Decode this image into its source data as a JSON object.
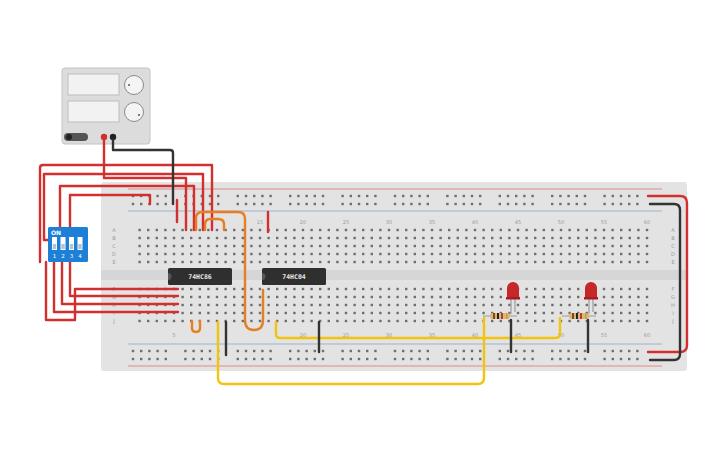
{
  "breadboard": {
    "top_column_labels": [
      "15",
      "20",
      "25",
      "30",
      "35",
      "40",
      "45",
      "50",
      "55",
      "60"
    ],
    "bottom_column_labels": [
      "5",
      "20",
      "25",
      "30",
      "35",
      "40",
      "45",
      "50",
      "55",
      "60"
    ],
    "row_labels_top": [
      "A",
      "B",
      "C",
      "D",
      "E"
    ],
    "row_labels_bottom": [
      "F",
      "G",
      "H",
      "I",
      "J"
    ]
  },
  "chips": [
    {
      "label": "74HC86"
    },
    {
      "label": "74HC04"
    }
  ],
  "dip_switch": {
    "label": "ON",
    "switches": [
      {
        "number": "1",
        "on": false
      },
      {
        "number": "2",
        "on": false
      },
      {
        "number": "3",
        "on": false
      },
      {
        "number": "4",
        "on": false
      }
    ]
  },
  "leds": [
    {
      "lit": false
    },
    {
      "lit": false
    }
  ],
  "power_supply": {
    "on": false
  }
}
